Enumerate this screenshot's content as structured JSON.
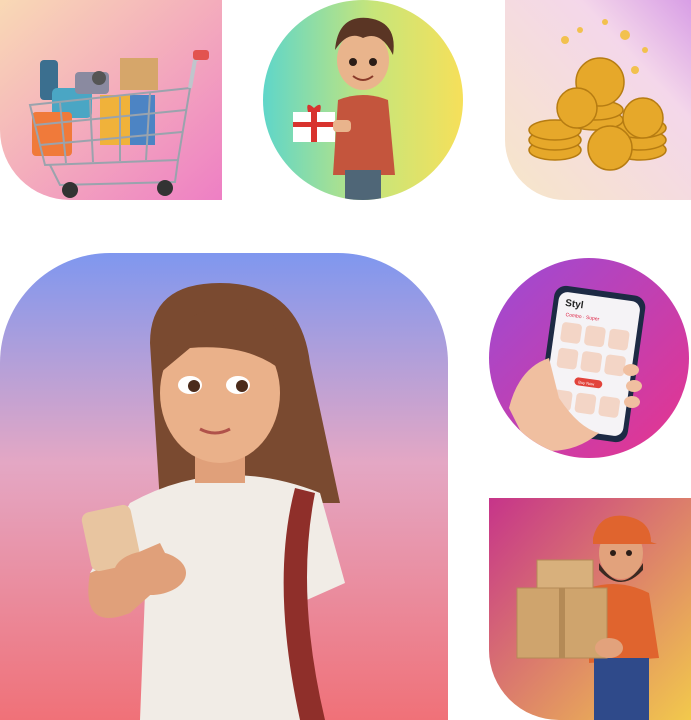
{
  "phone_app": {
    "brand": "Styl",
    "subtitle": "Combo · Super",
    "button": "Buy Now"
  },
  "colors": {
    "cart_bg": [
      "#f9d9b5",
      "#ee7fc4"
    ],
    "boy_bg": [
      "#5fd6c9",
      "#f6e05a"
    ],
    "coins_bg": [
      "#f7e6c8",
      "#d89ee6"
    ],
    "woman_bg": [
      "#7f97ef",
      "#f07178"
    ],
    "phone_bg": [
      "#9b4bd6",
      "#e8348c"
    ],
    "delivery_bg": [
      "#c6348a",
      "#f2c94c"
    ]
  }
}
